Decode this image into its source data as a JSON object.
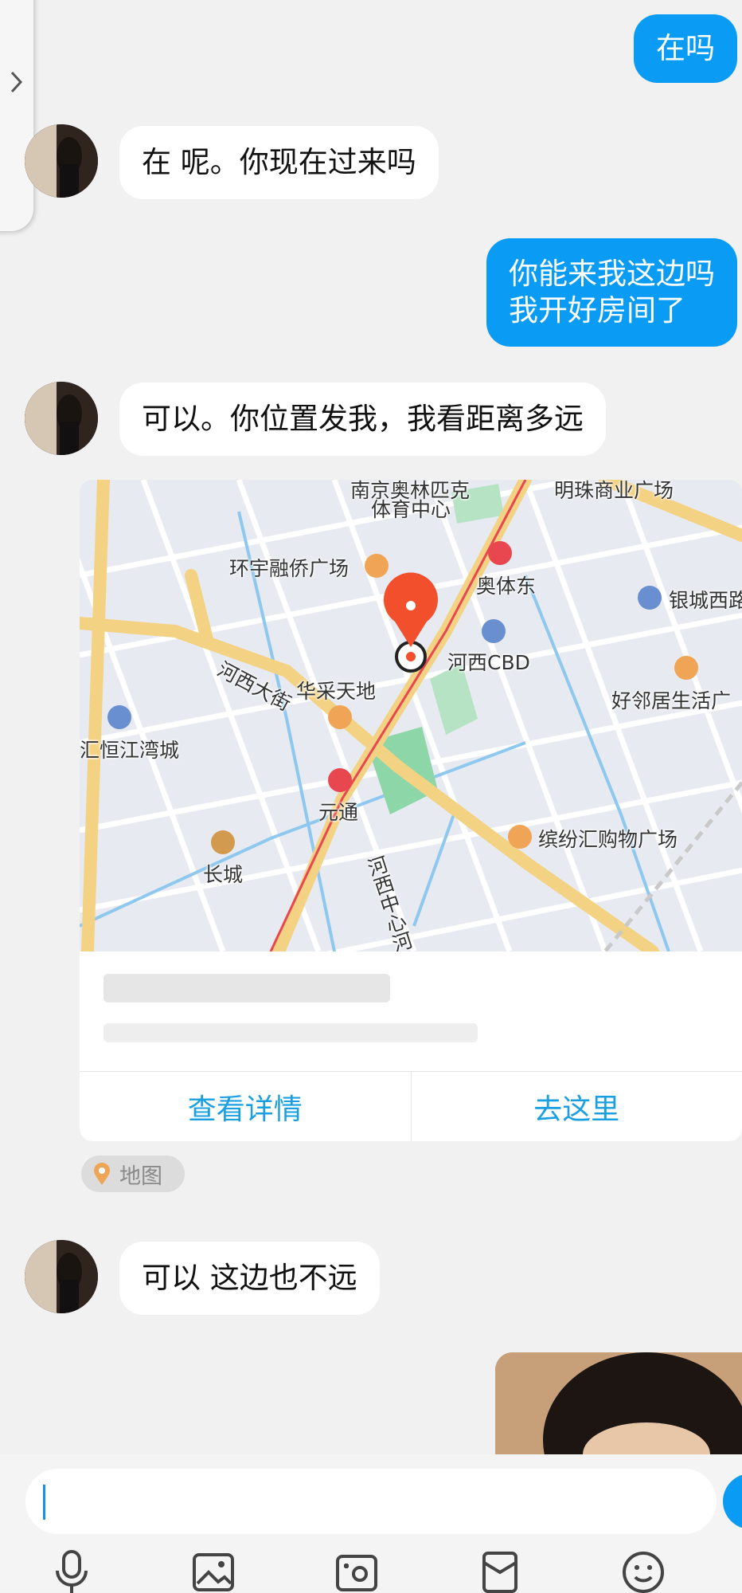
{
  "messages": {
    "m1_out": "在吗",
    "m2_in": "在 呢。你现在过来吗",
    "m3_out_line1": "你能来我这边吗",
    "m3_out_line2": "我开好房间了",
    "m4_in": "可以。你位置发我，我看距离多远",
    "m6_in": "可以 这边也不远"
  },
  "map_card": {
    "labels": {
      "stadium_1": "南京奥林匹克",
      "stadium_2": "体育中心",
      "mingzhu": "明珠商业广场",
      "huanyu": "环宇融侨广场",
      "aotidong": "奥体东",
      "yincheng": "银城西路",
      "hexi_cbd": "河西CBD",
      "haolinju": "好邻居生活广",
      "huacai": "华采天地",
      "hexi_street": "河西大街",
      "hengjiang": "汇恒江湾城",
      "yuantong": "元通",
      "changcheng": "长城",
      "binfen": "缤纷汇购物广场",
      "hexi_center": "河西中心河"
    },
    "actions": {
      "details": "查看详情",
      "go_here": "去这里"
    }
  },
  "tag": {
    "label": "地图",
    "icon": "location-pin-icon"
  },
  "input": {
    "placeholder": ""
  },
  "toolbar": {
    "icons": [
      "microphone-icon",
      "image-icon",
      "camera-icon",
      "red-packet-icon",
      "emoji-icon"
    ]
  },
  "colors": {
    "accent": "#0a9cf5",
    "link": "#1aa0e0",
    "pin": "#f2502c",
    "metro_red": "#e8474f",
    "poi_orange": "#f0a556"
  }
}
